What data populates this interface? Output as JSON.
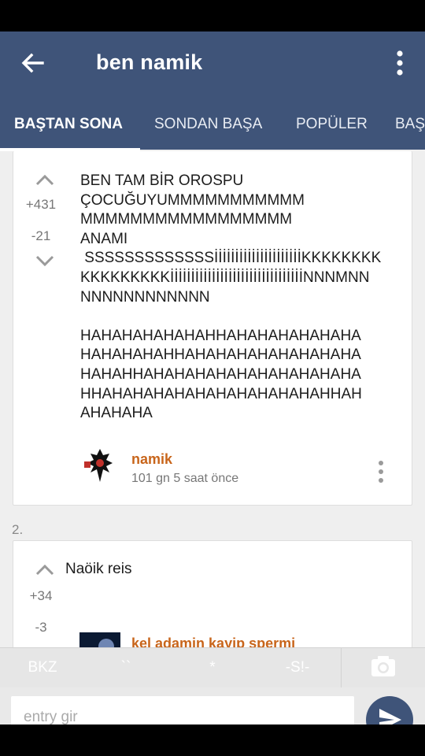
{
  "header": {
    "title": "ben namik",
    "back_icon": "arrow-left-icon",
    "menu_icon": "more-vert-icon",
    "tabs": [
      {
        "label": "BAŞTAN SONA",
        "active": true
      },
      {
        "label": "SONDAN BAŞA",
        "active": false
      },
      {
        "label": "POPÜLER",
        "active": false
      },
      {
        "label": "BAŞ",
        "active": false
      }
    ]
  },
  "entries": [
    {
      "upvotes": "+431",
      "downvotes": "-21",
      "text": "BEN TAM BİR OROSPU\nÇOCUĞUYUMMMMMMMMMMM\nMMMMMMMMMMMMMMMMM\nANAMI\n SSSSSSSSSSSSSİİİİİİİİİİİİİİİİİİİİİKKKKKKKK\nKKKKKKKKKİİİİİİİİİİİİİİİİİİİİİİİİİİİİİİİİNNNMNN\nNNNNNNNNNNNN\n\nHAHAHAHAHAHAHHAHAHAHAHAHAHA\nHAHAHAHAHHAHAHAHAHAHAHAHAHA\nHAHAHHAHAHAHAHAHAHAHAHAHAHA\nHHAHAHAHAHAHAHAHAHAHAHAHHAH\nAHAHAHA",
      "author": "namik",
      "time": "101 gn 5 saat  önce"
    },
    {
      "number": "2.",
      "upvotes": "+34",
      "downvotes": "-3",
      "text": "Naöik reis",
      "author": "kel adamin kayip spermi"
    }
  ],
  "bottom": {
    "quick_buttons": [
      "BKZ",
      "``",
      "*",
      "-S!-"
    ],
    "input_placeholder": "entry gir",
    "camera_icon": "camera-icon",
    "send_icon": "send-icon"
  },
  "colors": {
    "primary": "#3f5479",
    "author": "#c8651b",
    "background": "#efefef"
  }
}
